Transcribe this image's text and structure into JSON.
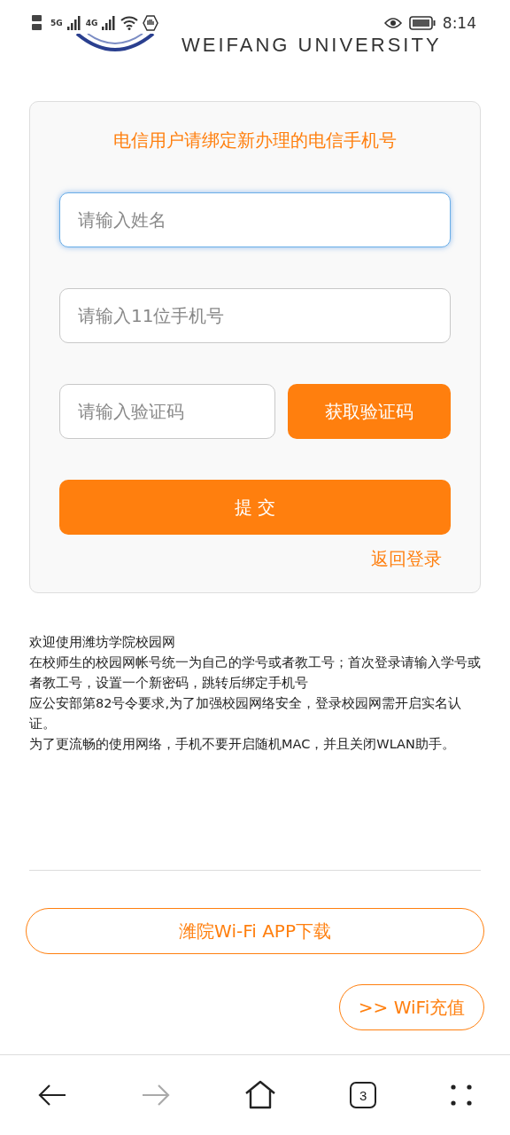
{
  "status_bar": {
    "network_1": "5G",
    "network_2": "4G",
    "time": "8:14"
  },
  "header": {
    "logo_text": "WEIFANG   UNIVERSITY"
  },
  "form": {
    "title": "电信用户请绑定新办理的电信手机号",
    "fields": [
      {
        "placeholder": "请输入姓名",
        "focused": true
      },
      {
        "placeholder": "请输入11位手机号",
        "focused": false
      }
    ],
    "code_field": {
      "placeholder": "请输入验证码"
    },
    "code_button": "获取验证码",
    "submit_button": "提 交",
    "back_link": "返回登录"
  },
  "notice": [
    "欢迎使用潍坊学院校园网",
    "在校师生的校园网帐号统一为自己的学号或者教工号；首次登录请输入学号或者教工号，设置一个新密码，跳转后绑定手机号",
    "应公安部第82号令要求,为了加强校园网络安全，登录校园网需开启实名认证。",
    "为了更流畅的使用网络，手机不要开启随机MAC，并且关闭WLAN助手。"
  ],
  "app_download_button": "潍院Wi-Fi APP下载",
  "recharge_button": ">> WiFi充值",
  "browser_nav": {
    "back_disabled": false,
    "forward_disabled": true,
    "tab_count": "3"
  }
}
